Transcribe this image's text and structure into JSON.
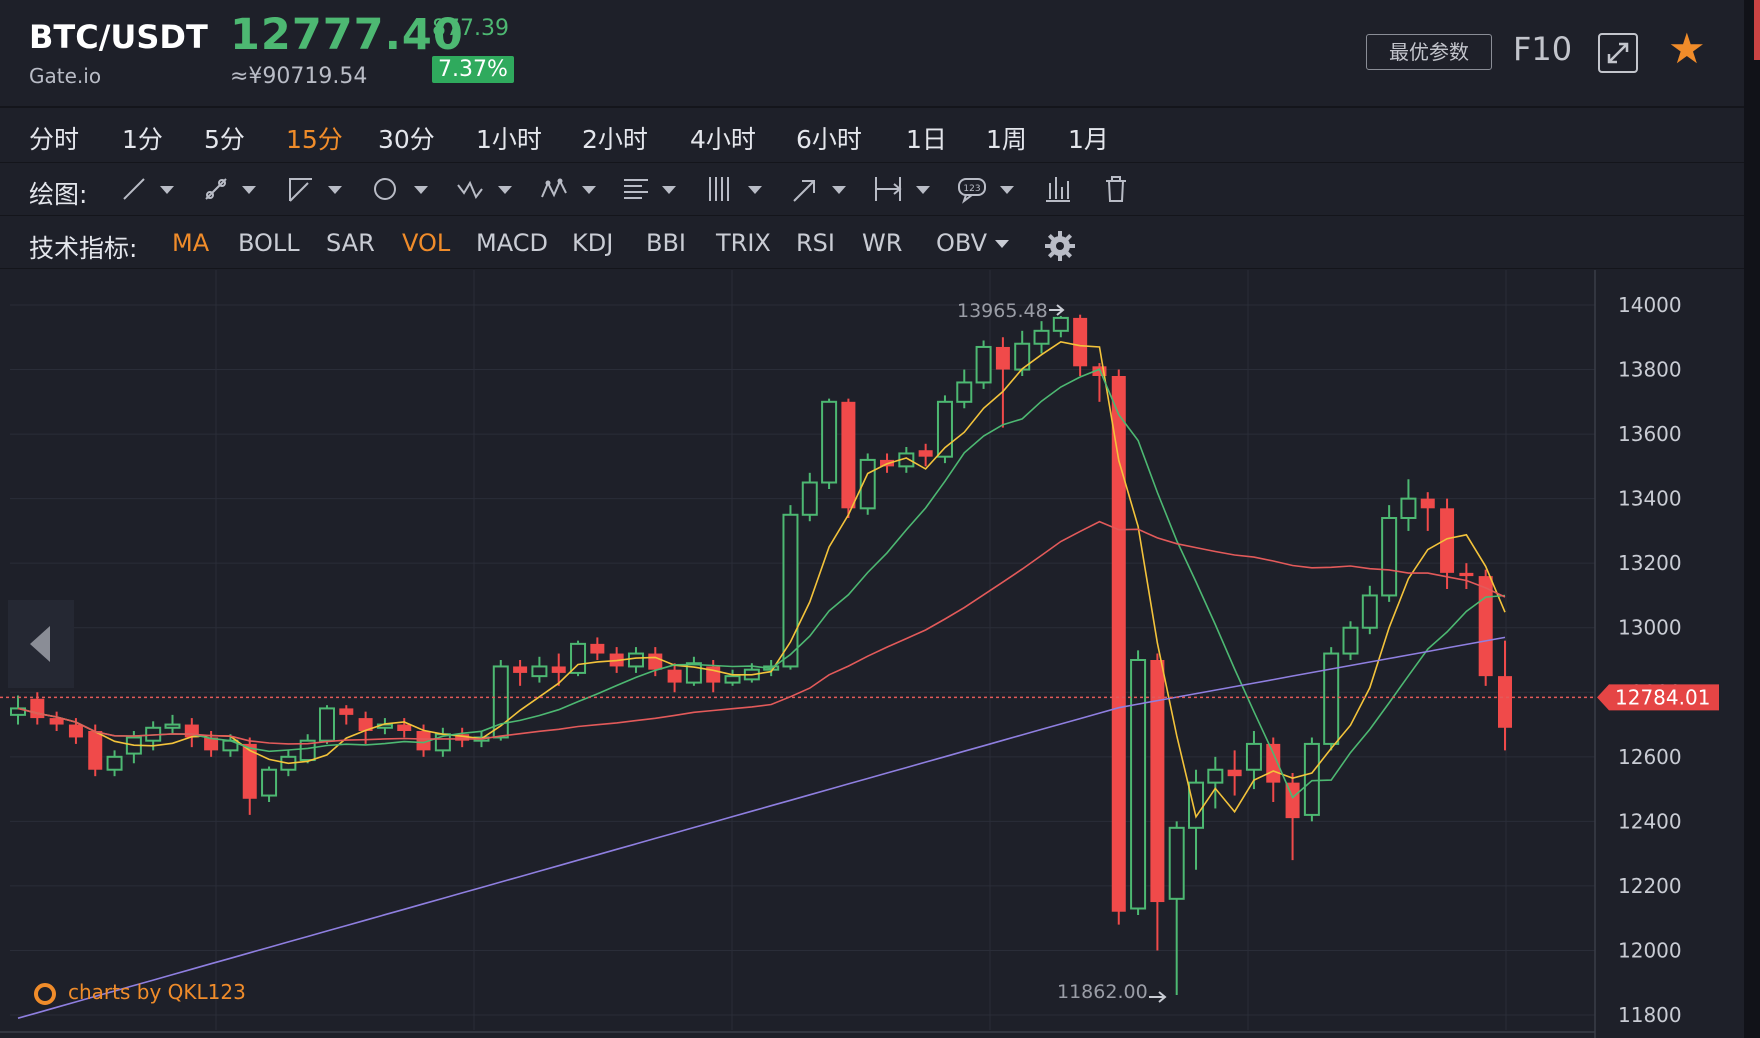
{
  "header": {
    "symbol": "BTC/USDT",
    "exchange": "Gate.io",
    "last_price": "12777.40",
    "cny_price": "≈¥90719.54",
    "change_abs": "877.39",
    "change_pct": "7.37%",
    "optimal_params": "最优参数",
    "f10": "F10",
    "icons": [
      "fullscreen-icon",
      "star-icon"
    ],
    "colors": {
      "up": "#4db872",
      "down": "#f04a4a",
      "accent": "#f08c2a"
    }
  },
  "periods": {
    "items": [
      "分时",
      "1分",
      "5分",
      "15分",
      "30分",
      "1小时",
      "2小时",
      "4小时",
      "6小时",
      "1日",
      "1周",
      "1月"
    ],
    "active": "15分"
  },
  "drawing": {
    "label": "绘图:",
    "tools": [
      "line-tool-icon",
      "segment-tool-icon",
      "angle-tool-icon",
      "shape-tool-icon",
      "wave-tool-icon",
      "pattern-tool-icon",
      "fib-tool-icon",
      "gann-tool-icon",
      "arrow-tool-icon",
      "measure-tool-icon",
      "label-tool-icon",
      "indicator-toggle-icon",
      "trash-icon"
    ],
    "label_tool_text": "123"
  },
  "indicators": {
    "label": "技术指标:",
    "items": [
      "MA",
      "BOLL",
      "SAR",
      "VOL",
      "MACD",
      "KDJ",
      "BBI",
      "TRIX",
      "RSI",
      "WR",
      "OBV"
    ],
    "active": [
      "MA",
      "VOL"
    ]
  },
  "chart": {
    "watermark": "charts by QKL123",
    "current_price_label": "12784.01",
    "high_marker": "13965.48",
    "low_marker": "11862.00"
  },
  "chart_data": {
    "type": "candlestick",
    "y_axis_ticks": [
      14000,
      13800,
      13600,
      13400,
      13200,
      13000,
      12800,
      12600,
      12400,
      12200,
      12000,
      11800
    ],
    "ylim": [
      11760,
      14080
    ],
    "current_price": 12784.01,
    "grid": true,
    "candles": [
      [
        12730,
        12750,
        12700,
        12790
      ],
      [
        12780,
        12720,
        12700,
        12800
      ],
      [
        12720,
        12700,
        12680,
        12740
      ],
      [
        12700,
        12660,
        12640,
        12720
      ],
      [
        12680,
        12560,
        12540,
        12700
      ],
      [
        12560,
        12600,
        12540,
        12620
      ],
      [
        12610,
        12660,
        12580,
        12680
      ],
      [
        12650,
        12690,
        12620,
        12710
      ],
      [
        12690,
        12700,
        12670,
        12730
      ],
      [
        12700,
        12660,
        12630,
        12720
      ],
      [
        12660,
        12620,
        12600,
        12680
      ],
      [
        12620,
        12650,
        12600,
        12670
      ],
      [
        12640,
        12470,
        12420,
        12660
      ],
      [
        12480,
        12560,
        12460,
        12570
      ],
      [
        12560,
        12600,
        12540,
        12620
      ],
      [
        12590,
        12650,
        12580,
        12670
      ],
      [
        12650,
        12750,
        12640,
        12760
      ],
      [
        12750,
        12730,
        12700,
        12760
      ],
      [
        12720,
        12680,
        12640,
        12740
      ],
      [
        12690,
        12700,
        12670,
        12720
      ],
      [
        12700,
        12680,
        12660,
        12720
      ],
      [
        12680,
        12620,
        12600,
        12700
      ],
      [
        12620,
        12670,
        12600,
        12690
      ],
      [
        12670,
        12650,
        12630,
        12690
      ],
      [
        12650,
        12660,
        12630,
        12680
      ],
      [
        12660,
        12880,
        12650,
        12900
      ],
      [
        12880,
        12860,
        12820,
        12900
      ],
      [
        12850,
        12880,
        12830,
        12910
      ],
      [
        12880,
        12860,
        12820,
        12920
      ],
      [
        12860,
        12950,
        12850,
        12960
      ],
      [
        12950,
        12920,
        12900,
        12970
      ],
      [
        12920,
        12880,
        12860,
        12940
      ],
      [
        12880,
        12920,
        12860,
        12940
      ],
      [
        12920,
        12870,
        12850,
        12940
      ],
      [
        12870,
        12830,
        12800,
        12890
      ],
      [
        12830,
        12890,
        12820,
        12910
      ],
      [
        12880,
        12830,
        12800,
        12900
      ],
      [
        12830,
        12850,
        12820,
        12870
      ],
      [
        12840,
        12870,
        12830,
        12890
      ],
      [
        12870,
        12880,
        12850,
        12900
      ],
      [
        12880,
        13350,
        12870,
        13380
      ],
      [
        13350,
        13450,
        13330,
        13480
      ],
      [
        13450,
        13700,
        13430,
        13710
      ],
      [
        13700,
        13370,
        13340,
        13710
      ],
      [
        13370,
        13520,
        13350,
        13540
      ],
      [
        13520,
        13500,
        13480,
        13540
      ],
      [
        13500,
        13540,
        13480,
        13560
      ],
      [
        13550,
        13530,
        13500,
        13570
      ],
      [
        13530,
        13700,
        13510,
        13720
      ],
      [
        13700,
        13760,
        13680,
        13800
      ],
      [
        13760,
        13870,
        13740,
        13890
      ],
      [
        13870,
        13800,
        13620,
        13900
      ],
      [
        13800,
        13880,
        13780,
        13920
      ],
      [
        13880,
        13920,
        13850,
        13950
      ],
      [
        13920,
        13960,
        13900,
        13966
      ],
      [
        13960,
        13810,
        13780,
        13970
      ],
      [
        13810,
        13780,
        13700,
        13820
      ],
      [
        13780,
        12120,
        12080,
        13800
      ],
      [
        12130,
        12900,
        12110,
        12930
      ],
      [
        12900,
        12150,
        12000,
        12920
      ],
      [
        12160,
        12380,
        11862,
        12400
      ],
      [
        12380,
        12520,
        12250,
        12560
      ],
      [
        12520,
        12560,
        12440,
        12600
      ],
      [
        12560,
        12540,
        12480,
        12620
      ],
      [
        12560,
        12640,
        12500,
        12680
      ],
      [
        12640,
        12520,
        12460,
        12660
      ],
      [
        12520,
        12410,
        12280,
        12550
      ],
      [
        12420,
        12640,
        12400,
        12660
      ],
      [
        12640,
        12920,
        12620,
        12940
      ],
      [
        12920,
        13000,
        12900,
        13020
      ],
      [
        13000,
        13100,
        12980,
        13130
      ],
      [
        13100,
        13340,
        13080,
        13380
      ],
      [
        13340,
        13400,
        13300,
        13460
      ],
      [
        13400,
        13370,
        13300,
        13420
      ],
      [
        13370,
        13170,
        13120,
        13400
      ],
      [
        13170,
        13160,
        13120,
        13200
      ],
      [
        13160,
        12850,
        12820,
        13180
      ],
      [
        12850,
        12690,
        12620,
        12960
      ]
    ],
    "series": [
      {
        "name": "MA5",
        "color": "#f3c33b"
      },
      {
        "name": "MA10",
        "color": "#4db872"
      },
      {
        "name": "MA30",
        "color": "#e35a5a"
      },
      {
        "name": "MA60",
        "color": "#8f7fe0"
      }
    ]
  }
}
